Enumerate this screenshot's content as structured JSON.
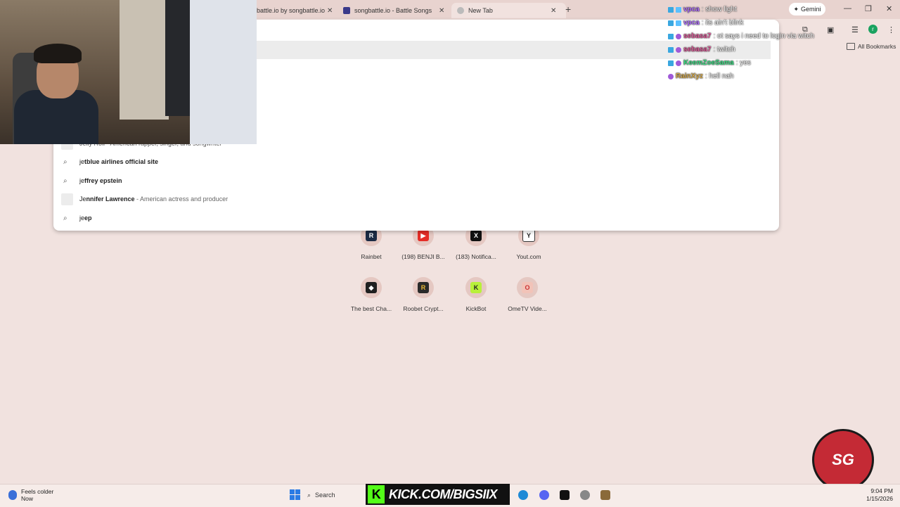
{
  "tabs": [
    {
      "label": "battle.io by songbattle.io",
      "active": false
    },
    {
      "label": "songbattle.io - Battle Songs ag",
      "active": false
    },
    {
      "label": "New Tab",
      "active": true
    }
  ],
  "toolbar": {
    "gemini_label": "Gemini",
    "profile_initial": "r",
    "all_bookmarks_label": "All Bookmarks"
  },
  "omnibox": {
    "partial_top": "Jelly Roll - American rapper, singer, and songwriter",
    "suggestions": [
      {
        "typed": "je",
        "rest": "tblue airlines official site",
        "desc": "",
        "icon": "search-icon"
      },
      {
        "typed": "je",
        "rest": "ffrey epstein",
        "desc": "",
        "icon": "search-icon"
      },
      {
        "typed": "Je",
        "rest": "nnifer Lawrence",
        "desc": " - American actress and producer",
        "icon": "thumbnail"
      },
      {
        "typed": "je",
        "rest": "ep",
        "desc": "",
        "icon": "search-icon"
      }
    ]
  },
  "shortcuts": [
    {
      "label": "Rainbet",
      "icon": "rainbet-icon",
      "color": "#1b2a44",
      "glyph": "R"
    },
    {
      "label": "(198) BENJI B...",
      "icon": "youtube-icon",
      "color": "#e52d27",
      "glyph": "▶"
    },
    {
      "label": "(183) Notifica...",
      "icon": "x-icon",
      "color": "#111111",
      "glyph": "X"
    },
    {
      "label": "Yout.com",
      "icon": "yout-icon",
      "color": "#ffffff",
      "glyph": "Y"
    },
    {
      "label": "The best Cha...",
      "icon": "chat-icon",
      "color": "#1f1f1f",
      "glyph": "◆"
    },
    {
      "label": "Roobet Crypt...",
      "icon": "roobet-icon",
      "color": "#2a2a2a",
      "glyph": "R"
    },
    {
      "label": "KickBot",
      "icon": "kickbot-icon",
      "color": "#b8f03a",
      "glyph": "K"
    },
    {
      "label": "OmeTV Vide...",
      "icon": "ometv-icon",
      "color": "#f2c3b8",
      "glyph": "O"
    }
  ],
  "chat": [
    {
      "user": "vpca",
      "msg": ": show light",
      "color": "#b070ff"
    },
    {
      "user": "vpca",
      "msg": ": its ain't blink",
      "color": "#b070ff"
    },
    {
      "user": "sebasa7",
      "msg": ": ot says i need to login via witch",
      "color": "#e05a9a"
    },
    {
      "user": "sebasa7",
      "msg": ": twitch",
      "color": "#e05a9a"
    },
    {
      "user": "KeemZoeSama",
      "msg": ": yes",
      "color": "#3ddc84"
    },
    {
      "user": "RainXyz",
      "msg": ": hell nah",
      "color": "#d4a84a"
    }
  ],
  "overlay": {
    "kick_text": "KICK.COM/BIGSIIX",
    "logo_text": "SG"
  },
  "taskbar": {
    "weather_title": "Feels colder",
    "weather_sub": "Now",
    "search_label": "Search",
    "time": "9:04 PM",
    "date": "1/15/2026"
  }
}
